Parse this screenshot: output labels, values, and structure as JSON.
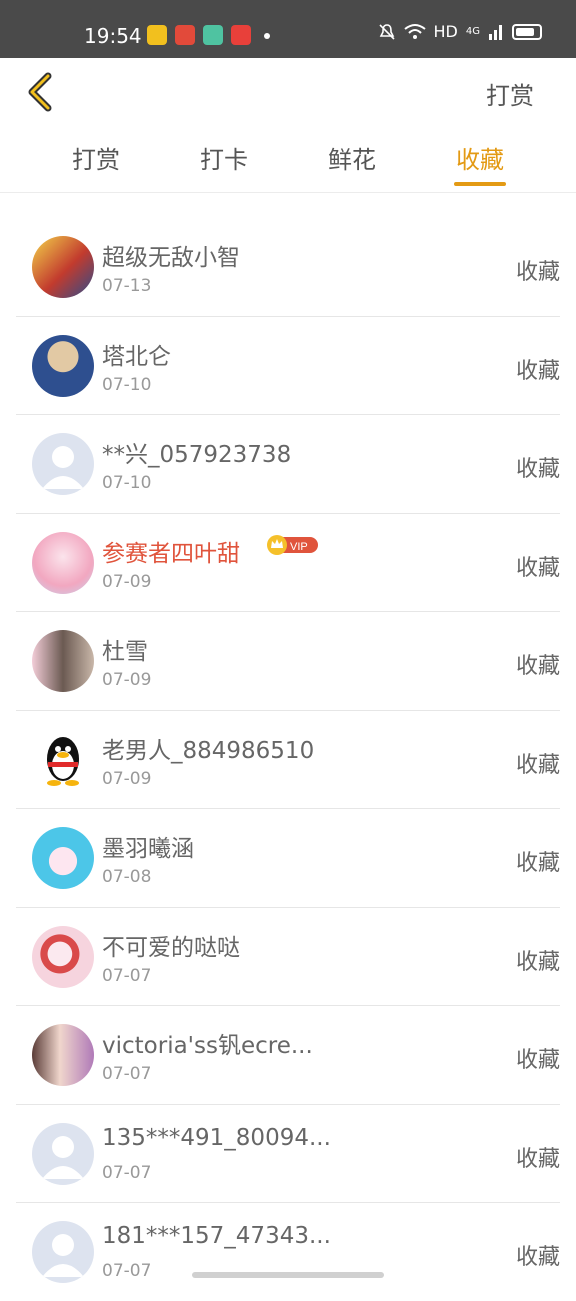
{
  "status_bar": {
    "time": "19:54",
    "network": "HD",
    "signal": "4G"
  },
  "header": {
    "right_label": "打赏"
  },
  "tabs": [
    {
      "label": "打赏",
      "active": false
    },
    {
      "label": "打卡",
      "active": false
    },
    {
      "label": "鲜花",
      "active": false
    },
    {
      "label": "收藏",
      "active": true
    }
  ],
  "accent_color": "#e39a14",
  "vip_color": "#e0543c",
  "items": [
    {
      "name": "超级无敌小智",
      "date": "07-13",
      "action": "收藏",
      "vip": false,
      "avatar": "pokemon-trainer"
    },
    {
      "name": "塔北仑",
      "date": "07-10",
      "action": "收藏",
      "vip": false,
      "avatar": "anime-character"
    },
    {
      "name": "**兴_057923738",
      "date": "07-10",
      "action": "收藏",
      "vip": false,
      "avatar": "default"
    },
    {
      "name": "参赛者四叶甜",
      "date": "07-09",
      "action": "收藏",
      "vip": true,
      "vip_label": "VIP",
      "avatar": "anime-girl-pink"
    },
    {
      "name": "杜雪",
      "date": "07-09",
      "action": "收藏",
      "vip": false,
      "avatar": "woman-photo"
    },
    {
      "name": "老男人_884986510",
      "date": "07-09",
      "action": "收藏",
      "vip": false,
      "avatar": "qq-penguin"
    },
    {
      "name": "墨羽曦涵",
      "date": "07-08",
      "action": "收藏",
      "vip": false,
      "avatar": "cute-pet"
    },
    {
      "name": "不可爱的哒哒",
      "date": "07-07",
      "action": "收藏",
      "vip": false,
      "avatar": "anime-girl-red"
    },
    {
      "name": "victoria'ss钒ecre...",
      "date": "07-07",
      "action": "收藏",
      "vip": false,
      "avatar": "girl-selfie"
    },
    {
      "name": "135***491_80094...",
      "date": "07-07",
      "action": "收藏",
      "vip": false,
      "avatar": "default"
    },
    {
      "name": "181***157_47343...",
      "date": "07-07",
      "action": "收藏",
      "vip": false,
      "avatar": "default"
    }
  ]
}
